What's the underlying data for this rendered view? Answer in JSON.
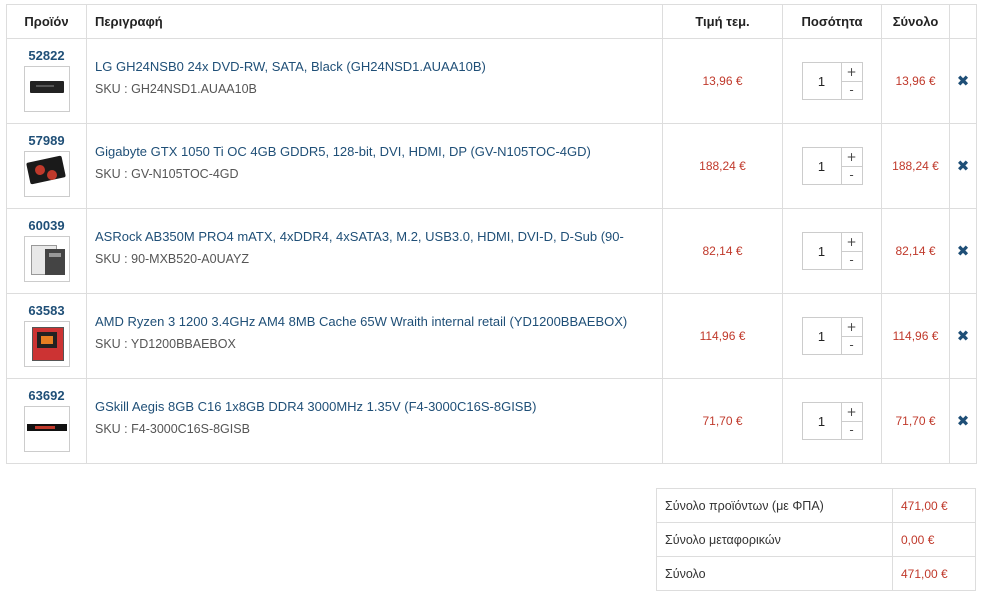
{
  "headers": {
    "product": "Προϊόν",
    "description": "Περιγραφή",
    "unit_price": "Τιμή τεμ.",
    "quantity": "Ποσότητα",
    "total": "Σύνολο"
  },
  "items": [
    {
      "code": "52822",
      "image_icon": "dvd-drive-image",
      "title": "LG GH24NSB0 24x DVD-RW, SATA, Black (GH24NSD1.AUAA10B)",
      "sku": "SKU : GH24NSD1.AUAA10B",
      "unit_price": "13,96 €",
      "qty": "1",
      "total": "13,96 €"
    },
    {
      "code": "57989",
      "image_icon": "graphics-card-image",
      "title": "Gigabyte GTX 1050 Ti OC 4GB GDDR5, 128-bit, DVI, HDMI, DP (GV-N105TOC-4GD)",
      "sku": "SKU : GV-N105TOC-4GD",
      "unit_price": "188,24 €",
      "qty": "1",
      "total": "188,24 €"
    },
    {
      "code": "60039",
      "image_icon": "motherboard-image",
      "title": "ASRock AB350M PRO4 mATX, 4xDDR4, 4xSATA3, M.2, USB3.0, HDMI, DVI-D, D-Sub (90-",
      "sku": "SKU : 90-MXB520-A0UAYZ",
      "unit_price": "82,14 €",
      "qty": "1",
      "total": "82,14 €"
    },
    {
      "code": "63583",
      "image_icon": "cpu-box-image",
      "title": "AMD Ryzen 3 1200 3.4GHz AM4 8MB Cache 65W Wraith internal retail (YD1200BBAEBOX)",
      "sku": "SKU : YD1200BBAEBOX",
      "unit_price": "114,96 €",
      "qty": "1",
      "total": "114,96 €"
    },
    {
      "code": "63692",
      "image_icon": "ram-module-image",
      "title": "GSkill Aegis 8GB C16 1x8GB DDR4 3000MHz 1.35V (F4-3000C16S-8GISB)",
      "sku": "SKU : F4-3000C16S-8GISB",
      "unit_price": "71,70 €",
      "qty": "1",
      "total": "71,70 €"
    }
  ],
  "controls": {
    "increment": "+",
    "decrement": "-",
    "remove": "✖"
  },
  "totals": {
    "products_label": "Σύνολο προϊόντων (με ΦΠΑ)",
    "products_value": "471,00 €",
    "shipping_label": "Σύνολο μεταφορικών",
    "shipping_value": "0,00 €",
    "grand_label": "Σύνολο",
    "grand_value": "471,00 €"
  },
  "colors": {
    "link": "#1f4f77",
    "price": "#c0392b",
    "border": "#dddddd"
  }
}
